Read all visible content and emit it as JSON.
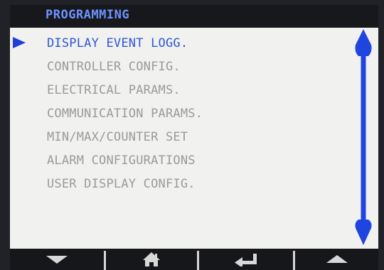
{
  "header": {
    "title": "PROGRAMMING"
  },
  "menu": {
    "items": [
      {
        "label": "DISPLAY EVENT LOGG.",
        "selected": true
      },
      {
        "label": "CONTROLLER CONFIG.",
        "selected": false
      },
      {
        "label": "ELECTRICAL PARAMS.",
        "selected": false
      },
      {
        "label": "COMMUNICATION PARAMS.",
        "selected": false
      },
      {
        "label": "MIN/MAX/COUNTER SET",
        "selected": false
      },
      {
        "label": "ALARM CONFIGURATIONS",
        "selected": false
      },
      {
        "label": "USER DISPLAY CONFIG.",
        "selected": false
      }
    ]
  },
  "footer": {
    "keys": [
      {
        "icon": "arrow-down-icon"
      },
      {
        "icon": "home-icon"
      },
      {
        "icon": "enter-icon"
      },
      {
        "icon": "arrow-up-icon"
      }
    ]
  },
  "colors": {
    "accent": "#2f57d6",
    "header_text": "#6f93ff",
    "screen_bg": "#f1f1ef",
    "inactive_text": "#9a9a98"
  }
}
